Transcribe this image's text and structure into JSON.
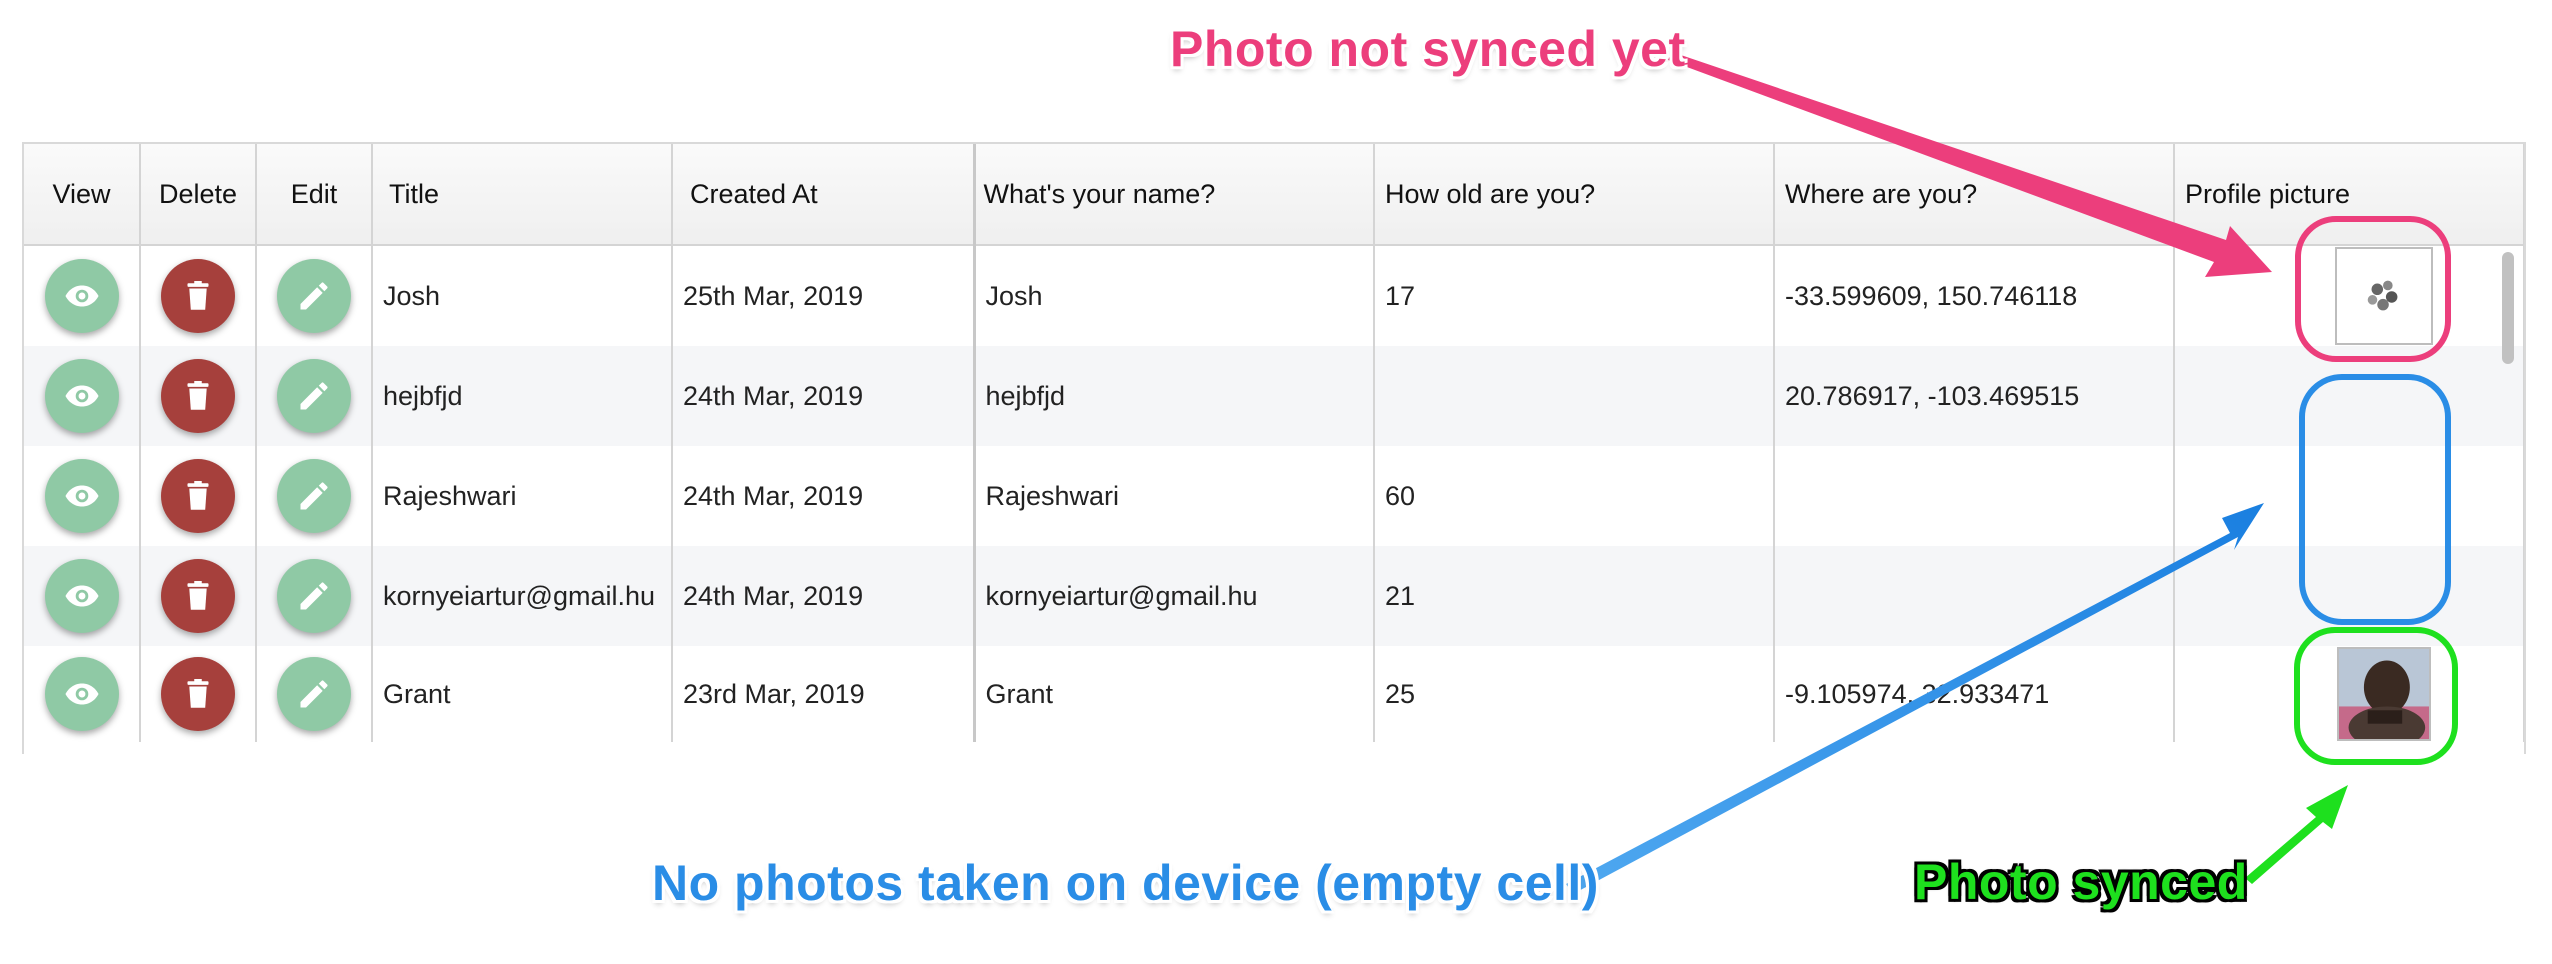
{
  "table": {
    "columns": [
      "View",
      "Delete",
      "Edit",
      "Title",
      "Created At",
      "What's your name?",
      "How old are you?",
      "Where are you?",
      "Profile picture"
    ],
    "rows": [
      {
        "title": "Josh",
        "created": "25th Mar, 2019",
        "name": "Josh",
        "age": "17",
        "location": "-33.599609, 150.746118",
        "picture": "loading"
      },
      {
        "title": "hejbfjd",
        "created": "24th Mar, 2019",
        "name": "hejbfjd",
        "age": "",
        "location": "20.786917, -103.469515",
        "picture": "empty"
      },
      {
        "title": "Rajeshwari",
        "created": "24th Mar, 2019",
        "name": "Rajeshwari",
        "age": "60",
        "location": "",
        "picture": "empty"
      },
      {
        "title": "kornyeiartur@gmail.hu",
        "created": "24th Mar, 2019",
        "name": "kornyeiartur@gmail.hu",
        "age": "21",
        "location": "",
        "picture": "empty"
      },
      {
        "title": "Grant",
        "created": "23rd Mar, 2019",
        "name": "Grant",
        "age": "25",
        "location": "-9.105974, 32.933471",
        "picture": "photo"
      }
    ],
    "row_actions": {
      "view_icon": "eye-icon",
      "delete_icon": "trash-icon",
      "edit_icon": "pencil-icon"
    }
  },
  "annotations": {
    "not_synced": "Photo not synced yet",
    "no_photos": "No photos taken on device (empty cell)",
    "synced": "Photo synced"
  },
  "colors": {
    "view_button": "#8fc9a5",
    "edit_button": "#8fc9a5",
    "delete_button": "#a6403c",
    "not_synced": "#ec3e7c",
    "no_photos": "#2a8de6",
    "synced": "#1ee01e"
  }
}
